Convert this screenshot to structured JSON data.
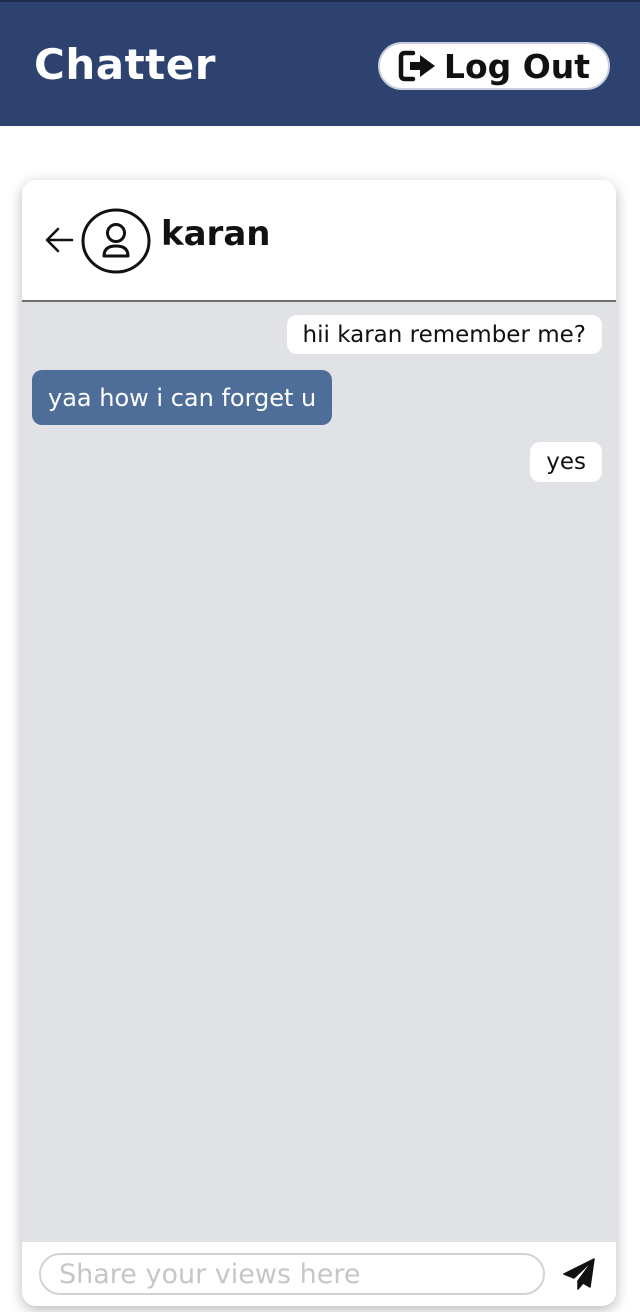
{
  "header": {
    "brand": "Chatter",
    "logout_label": "Log Out",
    "logout_icon": "sign-out-icon"
  },
  "chat": {
    "contact_name": "karan",
    "back_icon": "arrow-left-icon",
    "avatar_icon": "user-circle-icon",
    "messages": [
      {
        "direction": "sent",
        "text": "hii karan remember me?"
      },
      {
        "direction": "received",
        "text": "yaa how i can forget u"
      },
      {
        "direction": "sent",
        "text": "yes"
      }
    ]
  },
  "composer": {
    "placeholder": "Share your views here",
    "value": "",
    "send_icon": "paper-plane-icon"
  },
  "colors": {
    "navbar_bg": "#2e4270",
    "chat_bg": "#e1e2e6",
    "received_bubble": "#4e6e99",
    "sent_bubble": "#ffffff"
  }
}
